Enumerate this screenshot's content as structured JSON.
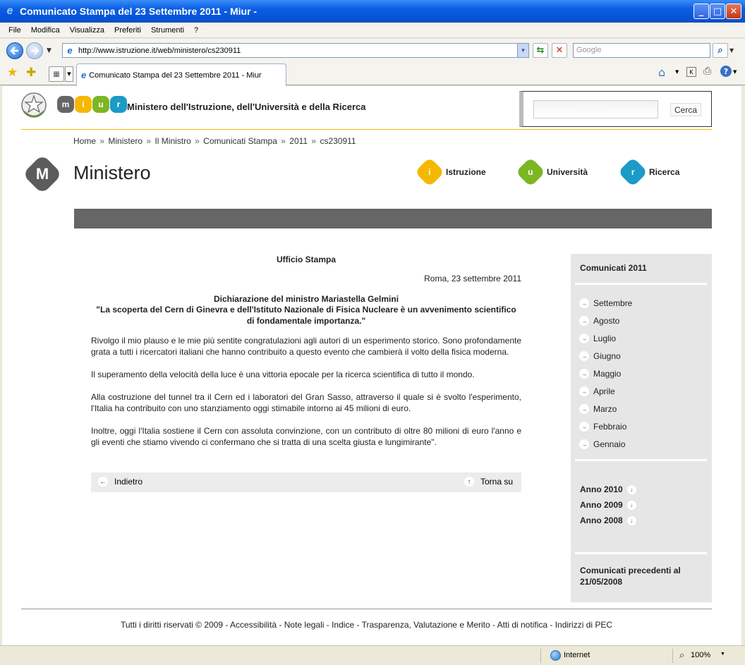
{
  "window": {
    "title": "Comunicato Stampa del 23 Settembre 2011 - Miur -",
    "buttons": {
      "minimize": "_",
      "maximize": "□",
      "close": "✕"
    }
  },
  "menu": [
    "File",
    "Modifica",
    "Visualizza",
    "Preferiti",
    "Strumenti",
    "?"
  ],
  "address": {
    "url": "http://www.istruzione.it/web/ministero/cs230911",
    "search_placeholder": "Google"
  },
  "tab": {
    "title": "Comunicato Stampa del 23 Settembre 2011 - Miur"
  },
  "header": {
    "logo_letters": [
      "m",
      "i",
      "u",
      "r"
    ],
    "org_name": "Ministero dell'Istruzione, dell'Università e della Ricerca",
    "search_button": "Cerca"
  },
  "breadcrumb": [
    "Home",
    "Ministero",
    "Il Ministro",
    "Comunicati Stampa",
    "2011",
    "cs230911"
  ],
  "breadcrumb_sep": "»",
  "section": {
    "title": "Ministero",
    "logo_letter": "M"
  },
  "portals": [
    {
      "letter": "i",
      "label": "Istruzione",
      "color": "#f5b800"
    },
    {
      "letter": "u",
      "label": "Università",
      "color": "#7cb623"
    },
    {
      "letter": "r",
      "label": "Ricerca",
      "color": "#1c9ac8"
    }
  ],
  "article": {
    "office": "Ufficio Stampa",
    "date": "Roma, 23 settembre 2011",
    "headline1": "Dichiarazione del ministro Mariastella Gelmini",
    "headline2": "\"La scoperta del Cern di Ginevra e dell'Istituto Nazionale di Fisica Nucleare è un avvenimento scientifico di fondamentale importanza.\"",
    "para1": "Rivolgo il mio plauso e le mie più sentite congratulazioni agli autori di un esperimento storico. Sono profondamente grata a tutti i ricercatori italiani che hanno contribuito a questo evento che cambierà il volto della fisica moderna.",
    "para1b": "Il superamento della velocità della luce è una vittoria epocale per la ricerca scientifica di tutto il mondo.",
    "para2": "Alla costruzione del tunnel tra il Cern ed i laboratori del Gran Sasso, attraverso il quale si è svolto l'esperimento, l'Italia ha contribuito con uno stanziamento oggi stimabile intorno ai 45 milioni di euro.",
    "para3": "Inoltre, oggi l'Italia sostiene il Cern con assoluta convinzione, con un contributo di oltre 80 milioni di euro l'anno e gli eventi che stiamo vivendo ci confermano che si tratta di una scelta giusta e lungimirante\"."
  },
  "article_nav": {
    "back": "Indietro",
    "top": "Torna su"
  },
  "sidebar": {
    "title": "Comunicati 2011",
    "months": [
      "Settembre",
      "Agosto",
      "Luglio",
      "Giugno",
      "Maggio",
      "Aprile",
      "Marzo",
      "Febbraio",
      "Gennaio"
    ],
    "years": [
      "Anno 2010",
      "Anno 2009",
      "Anno 2008"
    ],
    "older": "Comunicati precedenti al 21/05/2008"
  },
  "footer": "Tutti i diritti riservati © 2009 - Accessibilità - Note legali - Indice - Trasparenza, Valutazione e Merito - Atti di notifica - Indirizzi di PEC",
  "status": {
    "zone": "Internet",
    "zoom": "100%"
  }
}
